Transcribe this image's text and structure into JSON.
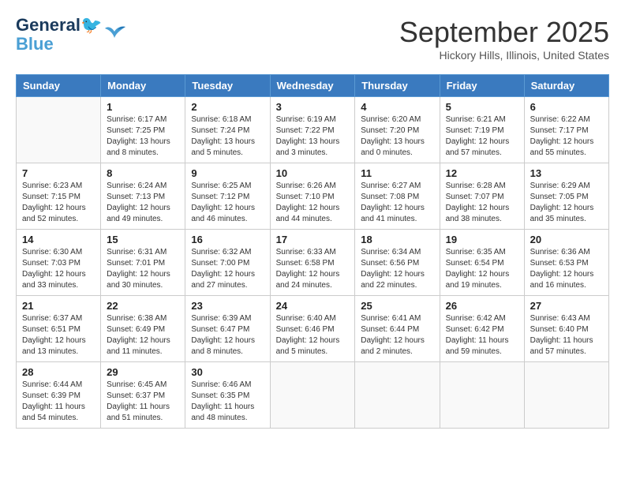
{
  "logo": {
    "line1": "General",
    "line2": "Blue"
  },
  "header": {
    "month": "September 2025",
    "location": "Hickory Hills, Illinois, United States"
  },
  "weekdays": [
    "Sunday",
    "Monday",
    "Tuesday",
    "Wednesday",
    "Thursday",
    "Friday",
    "Saturday"
  ],
  "weeks": [
    [
      {
        "day": "",
        "info": ""
      },
      {
        "day": "1",
        "info": "Sunrise: 6:17 AM\nSunset: 7:25 PM\nDaylight: 13 hours\nand 8 minutes."
      },
      {
        "day": "2",
        "info": "Sunrise: 6:18 AM\nSunset: 7:24 PM\nDaylight: 13 hours\nand 5 minutes."
      },
      {
        "day": "3",
        "info": "Sunrise: 6:19 AM\nSunset: 7:22 PM\nDaylight: 13 hours\nand 3 minutes."
      },
      {
        "day": "4",
        "info": "Sunrise: 6:20 AM\nSunset: 7:20 PM\nDaylight: 13 hours\nand 0 minutes."
      },
      {
        "day": "5",
        "info": "Sunrise: 6:21 AM\nSunset: 7:19 PM\nDaylight: 12 hours\nand 57 minutes."
      },
      {
        "day": "6",
        "info": "Sunrise: 6:22 AM\nSunset: 7:17 PM\nDaylight: 12 hours\nand 55 minutes."
      }
    ],
    [
      {
        "day": "7",
        "info": "Sunrise: 6:23 AM\nSunset: 7:15 PM\nDaylight: 12 hours\nand 52 minutes."
      },
      {
        "day": "8",
        "info": "Sunrise: 6:24 AM\nSunset: 7:13 PM\nDaylight: 12 hours\nand 49 minutes."
      },
      {
        "day": "9",
        "info": "Sunrise: 6:25 AM\nSunset: 7:12 PM\nDaylight: 12 hours\nand 46 minutes."
      },
      {
        "day": "10",
        "info": "Sunrise: 6:26 AM\nSunset: 7:10 PM\nDaylight: 12 hours\nand 44 minutes."
      },
      {
        "day": "11",
        "info": "Sunrise: 6:27 AM\nSunset: 7:08 PM\nDaylight: 12 hours\nand 41 minutes."
      },
      {
        "day": "12",
        "info": "Sunrise: 6:28 AM\nSunset: 7:07 PM\nDaylight: 12 hours\nand 38 minutes."
      },
      {
        "day": "13",
        "info": "Sunrise: 6:29 AM\nSunset: 7:05 PM\nDaylight: 12 hours\nand 35 minutes."
      }
    ],
    [
      {
        "day": "14",
        "info": "Sunrise: 6:30 AM\nSunset: 7:03 PM\nDaylight: 12 hours\nand 33 minutes."
      },
      {
        "day": "15",
        "info": "Sunrise: 6:31 AM\nSunset: 7:01 PM\nDaylight: 12 hours\nand 30 minutes."
      },
      {
        "day": "16",
        "info": "Sunrise: 6:32 AM\nSunset: 7:00 PM\nDaylight: 12 hours\nand 27 minutes."
      },
      {
        "day": "17",
        "info": "Sunrise: 6:33 AM\nSunset: 6:58 PM\nDaylight: 12 hours\nand 24 minutes."
      },
      {
        "day": "18",
        "info": "Sunrise: 6:34 AM\nSunset: 6:56 PM\nDaylight: 12 hours\nand 22 minutes."
      },
      {
        "day": "19",
        "info": "Sunrise: 6:35 AM\nSunset: 6:54 PM\nDaylight: 12 hours\nand 19 minutes."
      },
      {
        "day": "20",
        "info": "Sunrise: 6:36 AM\nSunset: 6:53 PM\nDaylight: 12 hours\nand 16 minutes."
      }
    ],
    [
      {
        "day": "21",
        "info": "Sunrise: 6:37 AM\nSunset: 6:51 PM\nDaylight: 12 hours\nand 13 minutes."
      },
      {
        "day": "22",
        "info": "Sunrise: 6:38 AM\nSunset: 6:49 PM\nDaylight: 12 hours\nand 11 minutes."
      },
      {
        "day": "23",
        "info": "Sunrise: 6:39 AM\nSunset: 6:47 PM\nDaylight: 12 hours\nand 8 minutes."
      },
      {
        "day": "24",
        "info": "Sunrise: 6:40 AM\nSunset: 6:46 PM\nDaylight: 12 hours\nand 5 minutes."
      },
      {
        "day": "25",
        "info": "Sunrise: 6:41 AM\nSunset: 6:44 PM\nDaylight: 12 hours\nand 2 minutes."
      },
      {
        "day": "26",
        "info": "Sunrise: 6:42 AM\nSunset: 6:42 PM\nDaylight: 11 hours\nand 59 minutes."
      },
      {
        "day": "27",
        "info": "Sunrise: 6:43 AM\nSunset: 6:40 PM\nDaylight: 11 hours\nand 57 minutes."
      }
    ],
    [
      {
        "day": "28",
        "info": "Sunrise: 6:44 AM\nSunset: 6:39 PM\nDaylight: 11 hours\nand 54 minutes."
      },
      {
        "day": "29",
        "info": "Sunrise: 6:45 AM\nSunset: 6:37 PM\nDaylight: 11 hours\nand 51 minutes."
      },
      {
        "day": "30",
        "info": "Sunrise: 6:46 AM\nSunset: 6:35 PM\nDaylight: 11 hours\nand 48 minutes."
      },
      {
        "day": "",
        "info": ""
      },
      {
        "day": "",
        "info": ""
      },
      {
        "day": "",
        "info": ""
      },
      {
        "day": "",
        "info": ""
      }
    ]
  ]
}
